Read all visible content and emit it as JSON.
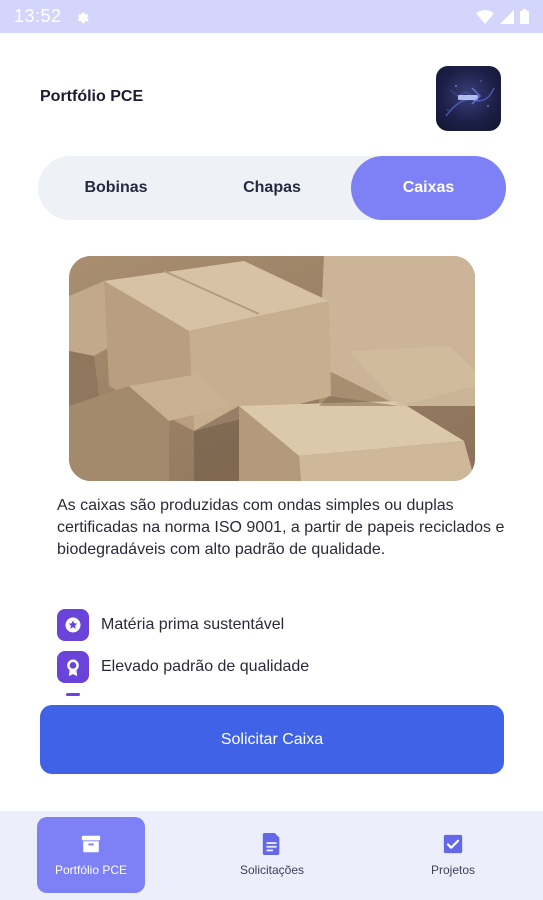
{
  "status_bar": {
    "time": "13:52"
  },
  "header": {
    "title": "Portfólio PCE",
    "logo_icon": "company-logo"
  },
  "tabs": [
    {
      "label": "Bobinas",
      "active": false
    },
    {
      "label": "Chapas",
      "active": false
    },
    {
      "label": "Caixas",
      "active": true
    }
  ],
  "content": {
    "image_subject": "cardboard-boxes-photo",
    "description": "As caixas são produzidas com ondas simples ou duplas certificadas na norma ISO 9001, a partir de papeis reciclados e biodegradáveis com alto padrão de qualidade.",
    "features": [
      {
        "icon": "star-icon",
        "label": "Matéria prima sustentável"
      },
      {
        "icon": "award-icon",
        "label": "Elevado padrão de qualidade"
      }
    ]
  },
  "cta": {
    "label": "Solicitar Caixa"
  },
  "bottom_nav": [
    {
      "icon": "archive-icon",
      "label": "Portfólio PCE",
      "active": true
    },
    {
      "icon": "document-icon",
      "label": "Solicitações",
      "active": false
    },
    {
      "icon": "checkbox-icon",
      "label": "Projetos",
      "active": false
    }
  ],
  "colors": {
    "accent": "#7e80f5",
    "primary_button": "#4062e6",
    "feature_icon": "#6a44d8",
    "status_bar": "#d3d5fb"
  }
}
